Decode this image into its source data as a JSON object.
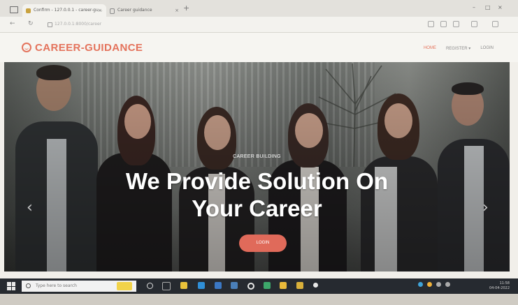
{
  "browser": {
    "tabs": [
      {
        "label": "Confirm - 127.0.0.1 - career-gu…",
        "active": true
      },
      {
        "label": "Career guidance",
        "active": false
      }
    ],
    "new_tab": "+",
    "address": "127.0.0.1:8000/career",
    "window_controls": [
      "–",
      "□",
      "×"
    ]
  },
  "site": {
    "logo_text": "CAREER-GUIDANCE",
    "nav": [
      {
        "label": "HOME",
        "active": true
      },
      {
        "label": "REGISTER ▾",
        "active": false
      },
      {
        "label": "LOGIN",
        "active": false
      }
    ],
    "brand_color": "#e4735c"
  },
  "hero": {
    "kicker": "CAREER BUILDING",
    "headline_line1": "We Provide Solution On",
    "headline_line2": "Your Career",
    "cta_label": "LOGIN",
    "prev_arrow": "‹",
    "next_arrow": "›"
  },
  "taskbar": {
    "search_placeholder": "Type here to search",
    "time": "11:58",
    "date": "04-04-2022"
  }
}
